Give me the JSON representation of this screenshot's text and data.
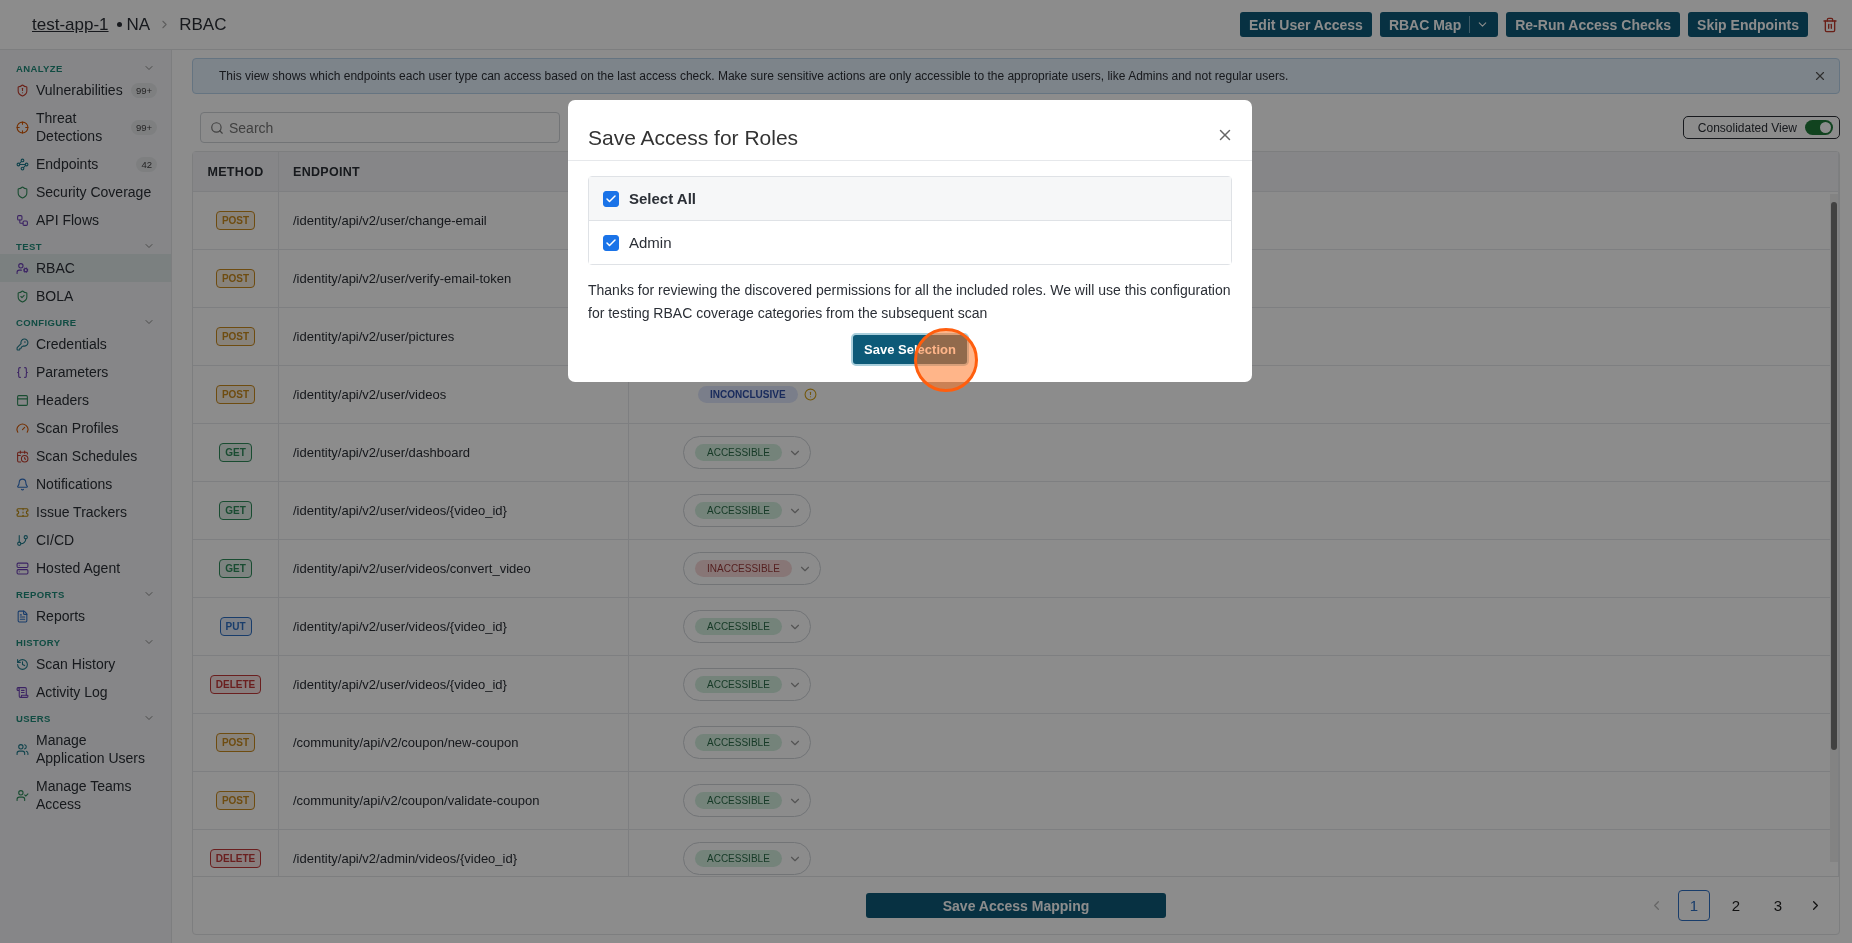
{
  "header": {
    "app_link": "test-app-1",
    "environment": "NA",
    "page": "RBAC",
    "actions": [
      {
        "label": "Edit User Access",
        "kind": "button"
      },
      {
        "label": "RBAC Map",
        "kind": "split"
      },
      {
        "label": "Re-Run Access Checks",
        "kind": "button"
      },
      {
        "label": "Skip Endpoints",
        "kind": "button"
      }
    ]
  },
  "sidebar": {
    "sections": [
      {
        "title": "ANALYZE",
        "expanded": true,
        "items": [
          {
            "label": "Vulnerabilities",
            "badge": "99+",
            "selected": false
          },
          {
            "label": "Threat Detections",
            "badge": "99+",
            "selected": false
          },
          {
            "label": "Endpoints",
            "badge": "42",
            "selected": false
          },
          {
            "label": "Security Coverage",
            "selected": false
          },
          {
            "label": "API Flows",
            "selected": false
          }
        ]
      },
      {
        "title": "TEST",
        "expanded": true,
        "items": [
          {
            "label": "RBAC",
            "selected": true
          },
          {
            "label": "BOLA",
            "selected": false
          }
        ]
      },
      {
        "title": "CONFIGURE",
        "expanded": true,
        "items": [
          {
            "label": "Credentials",
            "selected": false
          },
          {
            "label": "Parameters",
            "selected": false
          },
          {
            "label": "Headers",
            "selected": false
          },
          {
            "label": "Scan Profiles",
            "selected": false
          },
          {
            "label": "Scan Schedules",
            "selected": false
          },
          {
            "label": "Notifications",
            "selected": false
          },
          {
            "label": "Issue Trackers",
            "selected": false
          },
          {
            "label": "CI/CD",
            "selected": false
          },
          {
            "label": "Hosted Agent",
            "selected": false
          }
        ]
      },
      {
        "title": "REPORTS",
        "expanded": true,
        "items": [
          {
            "label": "Reports",
            "selected": false
          }
        ]
      },
      {
        "title": "HISTORY",
        "expanded": true,
        "items": [
          {
            "label": "Scan History",
            "selected": false
          },
          {
            "label": "Activity Log",
            "selected": false
          }
        ]
      },
      {
        "title": "USERS",
        "expanded": true,
        "items": [
          {
            "label": "Manage Application Users",
            "selected": false
          },
          {
            "label": "Manage Teams Access",
            "selected": false
          }
        ]
      }
    ]
  },
  "banner": {
    "text": "This view shows which endpoints each user type can access based on the last access check. Make sure sensitive actions are only accessible to the appropriate users, like Admins and not regular users."
  },
  "search": {
    "placeholder": "Search"
  },
  "consolidated_view": {
    "label": "Consolidated View",
    "on": true
  },
  "table": {
    "columns": [
      "METHOD",
      "ENDPOINT"
    ],
    "rows": [
      {
        "method": "POST",
        "kind": "post",
        "endpoint": "/identity/api/v2/user/change-email"
      },
      {
        "method": "POST",
        "kind": "post",
        "endpoint": "/identity/api/v2/user/verify-email-token"
      },
      {
        "method": "POST",
        "kind": "post",
        "endpoint": "/identity/api/v2/user/pictures"
      },
      {
        "method": "POST",
        "kind": "post",
        "endpoint": "/identity/api/v2/user/videos",
        "access": {
          "label": "INCONCLUSIVE",
          "kind": "inconclusive"
        }
      },
      {
        "method": "GET",
        "kind": "get",
        "endpoint": "/identity/api/v2/user/dashboard",
        "access": {
          "label": "ACCESSIBLE",
          "kind": "accessible"
        }
      },
      {
        "method": "GET",
        "kind": "get",
        "endpoint": "/identity/api/v2/user/videos/{video_id}",
        "access": {
          "label": "ACCESSIBLE",
          "kind": "accessible"
        }
      },
      {
        "method": "GET",
        "kind": "get",
        "endpoint": "/identity/api/v2/user/videos/convert_video",
        "access": {
          "label": "INACCESSIBLE",
          "kind": "inaccessible"
        }
      },
      {
        "method": "PUT",
        "kind": "put",
        "endpoint": "/identity/api/v2/user/videos/{video_id}",
        "access": {
          "label": "ACCESSIBLE",
          "kind": "accessible"
        }
      },
      {
        "method": "DELETE",
        "kind": "delete",
        "endpoint": "/identity/api/v2/user/videos/{video_id}",
        "access": {
          "label": "ACCESSIBLE",
          "kind": "accessible"
        }
      },
      {
        "method": "POST",
        "kind": "post",
        "endpoint": "/community/api/v2/coupon/new-coupon",
        "access": {
          "label": "ACCESSIBLE",
          "kind": "accessible"
        }
      },
      {
        "method": "POST",
        "kind": "post",
        "endpoint": "/community/api/v2/coupon/validate-coupon",
        "access": {
          "label": "ACCESSIBLE",
          "kind": "accessible"
        }
      },
      {
        "method": "DELETE",
        "kind": "delete",
        "endpoint": "/identity/api/v2/admin/videos/{video_id}",
        "access": {
          "label": "ACCESSIBLE",
          "kind": "accessible"
        }
      }
    ]
  },
  "footer": {
    "save_button": "Save Access Mapping",
    "prev_disabled": true,
    "pages": [
      {
        "label": "1",
        "selected": true
      },
      {
        "label": "2",
        "selected": false
      },
      {
        "label": "3",
        "selected": false
      }
    ]
  },
  "modal": {
    "title": "Save Access for Roles",
    "select_all": {
      "label": "Select All",
      "checked": true
    },
    "roles": [
      {
        "label": "Admin",
        "checked": true
      }
    ],
    "message": "Thanks for reviewing the discovered permissions for all the included roles. We will use this configuration for testing RBAC coverage categories from the subsequent scan",
    "button": "Save Selection"
  }
}
